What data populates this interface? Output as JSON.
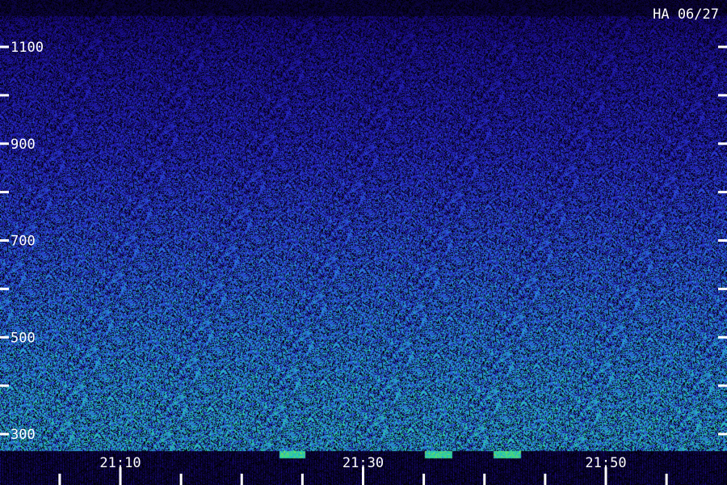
{
  "chart_data": {
    "type": "heatmap",
    "title": "HA 06/27",
    "xlabel": "",
    "ylabel": "",
    "x_tick_labels": [
      "21:10",
      "21:30",
      "21:50"
    ],
    "y_tick_labels": [
      "1100",
      "900",
      "700",
      "500",
      "300"
    ],
    "y_ticks": [
      1100,
      1000,
      900,
      800,
      700,
      600,
      500,
      400,
      300
    ],
    "ylim": [
      280,
      1180
    ],
    "x_minor_ticks": [
      "21:05",
      "21:10",
      "21:15",
      "21:20",
      "21:25",
      "21:30",
      "21:35",
      "21:40",
      "21:45",
      "21:50",
      "21:55",
      "22:00"
    ],
    "xlim": [
      "21:00",
      "22:00"
    ],
    "intensity_profile": {
      "frequency": [
        300,
        400,
        500,
        600,
        700,
        800,
        900,
        1000,
        1100,
        1180
      ],
      "relative_intensity": [
        0.62,
        0.58,
        0.52,
        0.46,
        0.4,
        0.34,
        0.28,
        0.24,
        0.2,
        0.14
      ]
    },
    "colormap": [
      "#000000",
      "#1a0a8c",
      "#2a3cd6",
      "#2a8ad6",
      "#22c7c0",
      "#39e07a",
      "#c8e020"
    ],
    "grid": false
  }
}
